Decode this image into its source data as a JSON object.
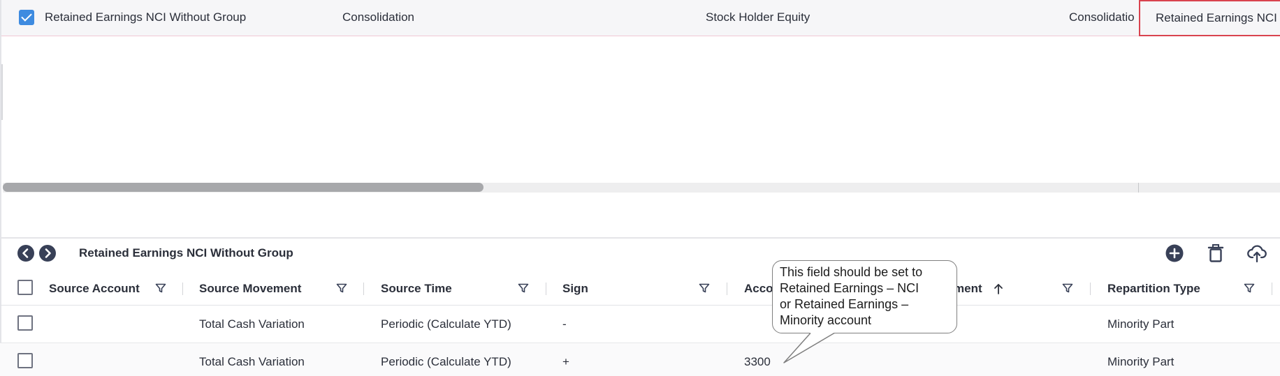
{
  "top_grid": {
    "row": {
      "checked": true,
      "name": "Retained Earnings NCI Without Group",
      "category": "Consolidation",
      "type": "Stock Holder Equity",
      "group": "Consolidatio",
      "selected_value": "Retained Earnings NCI"
    }
  },
  "panel": {
    "title": "Retained Earnings NCI Without Group",
    "toolbar": [
      "add-icon",
      "delete-icon",
      "upload-icon"
    ],
    "columns": [
      "Source Account",
      "Source Movement",
      "Source Time",
      "Sign",
      "Acco",
      "ment",
      "Repartition Type"
    ],
    "rows": [
      {
        "source_account": "",
        "source_movement": "Total Cash Variation",
        "source_time": "Periodic (Calculate YTD)",
        "sign": "-",
        "account": "",
        "repartition_type": "Minority Part"
      },
      {
        "source_account": "",
        "source_movement": "Total Cash Variation",
        "source_time": "Periodic (Calculate YTD)",
        "sign": "+",
        "account": "3300",
        "repartition_type": "Minority Part"
      }
    ]
  },
  "callout": {
    "lines": [
      "This field should be set to",
      "Retained  Earnings – NCI",
      "or  Retained  Earnings –",
      "Minority account"
    ]
  },
  "colors": {
    "accent_checkbox": "#3e8be0",
    "selection_border": "#d9434f",
    "icon_dark": "#384057"
  }
}
